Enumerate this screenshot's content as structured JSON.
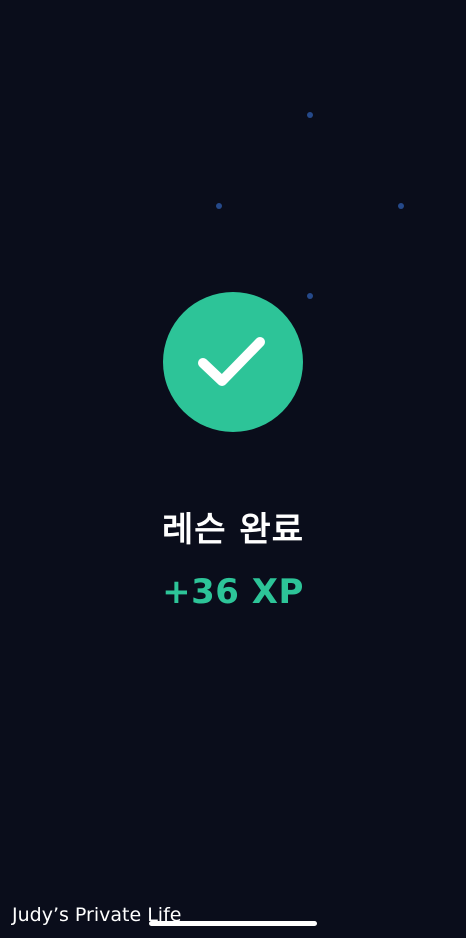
{
  "completion": {
    "title": "레슨 완료",
    "xp_reward": "+36 XP"
  },
  "watermark": "Judy’s Private Life",
  "icons": {
    "check": "checkmark-icon"
  },
  "colors": {
    "background": "#0a0d1b",
    "accent": "#2dc498",
    "confetti_dot": "#25498a",
    "text_primary": "#ffffff"
  }
}
